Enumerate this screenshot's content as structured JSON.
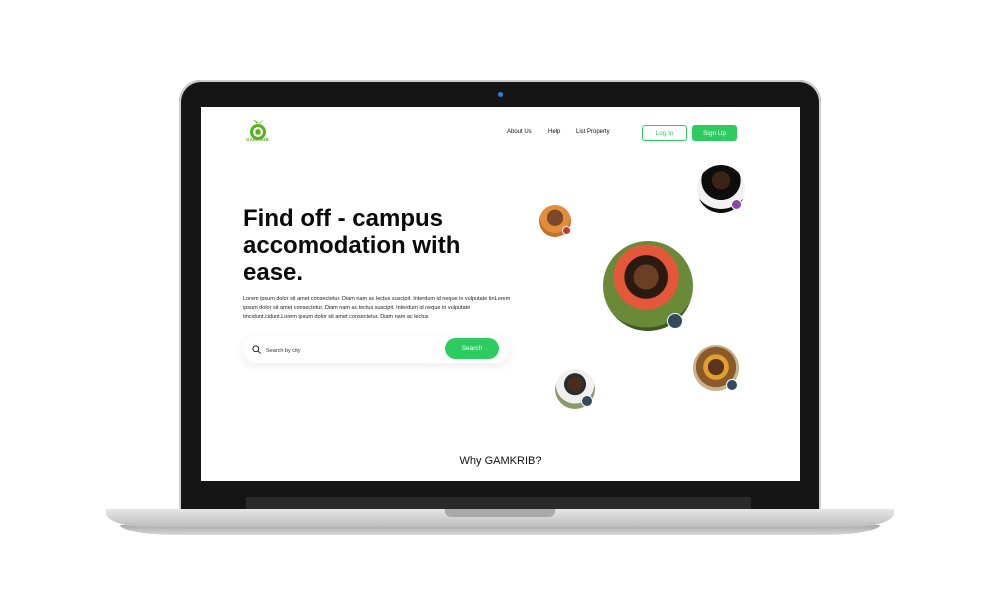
{
  "brand": {
    "name": "GAMKRIB",
    "color": "#56b31f"
  },
  "nav": {
    "about": "About Us",
    "help": "Help",
    "list_property": "List Property",
    "login": "Log In",
    "signup": "Sign Up"
  },
  "hero": {
    "title": "Find off - campus accomodation with ease.",
    "body": "Lorem ipsum dolor sit amet consectetur. Diam nam ac lectus suscipit. Interdum id neque in vulputate tinLorem ipsum dolor sit amet consectetur. Diam nam ac lectus suscipit. Interdum id neque in vulputate tincidunt.cidunt.Lorem ipsum dolor sit amet consectetur. Diam nam ac lectus"
  },
  "search": {
    "placeholder": "Search by city",
    "button": "Search",
    "icon": "search-icon"
  },
  "section": {
    "title": "Why GAMKRIB?"
  },
  "colors": {
    "accent": "#2ecc60"
  }
}
